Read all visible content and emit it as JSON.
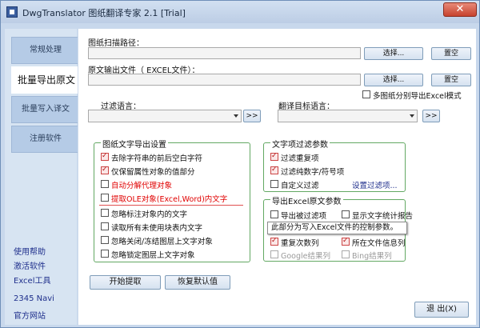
{
  "window": {
    "title": "DwgTranslator 图纸翻译专家 2.1 [Trial]",
    "close_label": "✕"
  },
  "sidebar": {
    "tabs": [
      "常规处理",
      "批量导出原文",
      "批量写入译文",
      "注册软件"
    ],
    "links": [
      "使用帮助",
      "激活软件",
      "Excel工具",
      "2345 Navi",
      "官方网站"
    ]
  },
  "paths": {
    "scan_label": "图纸扫描路径：",
    "scan_value": "",
    "output_label": "原文输出文件（ EXCEL文件）：",
    "output_value": "",
    "browse": "选择...",
    "clear": "置空",
    "multi_export": "多图纸分别导出Excel模式",
    "multi_export_checked": false
  },
  "language": {
    "filter_label": "过滤语言：",
    "target_label": "翻译目标语言：",
    "filter_value": "",
    "target_value": "",
    "more": ">>"
  },
  "export_settings": {
    "title": "图纸文字导出设置",
    "items": [
      {
        "label": "去除字符串的前后空白字符",
        "checked": true,
        "style": ""
      },
      {
        "label": "仅保留属性对象的值部分",
        "checked": true,
        "style": ""
      },
      {
        "label": "自动分解代理对象",
        "checked": false,
        "style": "red"
      },
      {
        "label": "提取OLE对象(Excel,Word)内文字",
        "checked": false,
        "style": "red"
      },
      {
        "label": "忽略标注对象内的文字",
        "checked": false,
        "style": ""
      },
      {
        "label": "读取所有未使用块表内文字",
        "checked": false,
        "style": ""
      },
      {
        "label": "忽略关闭/冻结图层上文字对象",
        "checked": false,
        "style": ""
      },
      {
        "label": "忽略锁定图层上文字对象",
        "checked": false,
        "style": ""
      }
    ]
  },
  "text_filter": {
    "title": "文字项过滤参数",
    "items": [
      {
        "label": "过滤重复项",
        "checked": true
      },
      {
        "label": "过滤纯数字/符号项",
        "checked": true
      },
      {
        "label": "自定义过滤",
        "checked": false
      }
    ],
    "settings_link": "设置过滤项..."
  },
  "excel_params": {
    "title": "导出Excel原文参数",
    "export_filtered": {
      "label": "导出被过滤项",
      "checked": false
    },
    "show_stats": {
      "label": "显示文字统计报告",
      "checked": false
    },
    "tooltip": "此部分为写入Excel文件的控制参数。",
    "repeat_count": {
      "label": "重复次数列",
      "checked": true
    },
    "file_info": {
      "label": "所在文件信息列",
      "checked": true
    },
    "google": {
      "label": "Google结果列",
      "checked": false
    },
    "bing": {
      "label": "Bing结果列",
      "checked": false
    }
  },
  "actions": {
    "start": "开始提取",
    "reset": "恢复默认值",
    "exit": "退 出(X)"
  }
}
